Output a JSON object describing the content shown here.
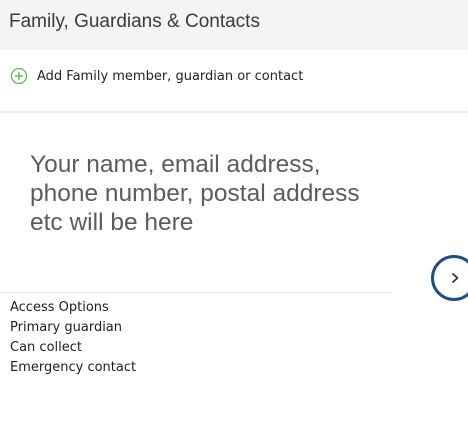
{
  "header": {
    "title": "Family, Guardians & Contacts"
  },
  "add_contact": {
    "label": "Add Family member, guardian or contact",
    "icon": "plus-circle-icon",
    "icon_color": "#5cb85c"
  },
  "contact_card": {
    "placeholder": "Your name, email address, phone number, postal address etc will be here",
    "next_icon": "chevron-right-icon",
    "accent_color": "#1f4e87"
  },
  "access_options": {
    "heading": "Access Options",
    "items": [
      "Primary guardian",
      "Can collect",
      "Emergency contact"
    ]
  }
}
